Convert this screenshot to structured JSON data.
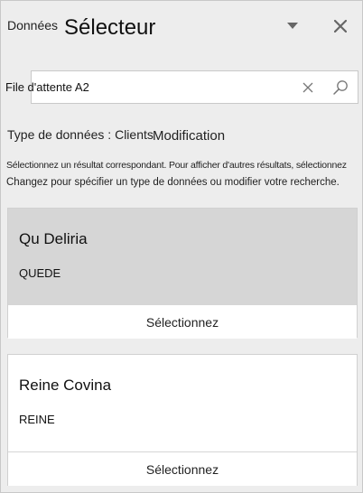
{
  "header": {
    "crumb": "Données",
    "title": "Sélecteur"
  },
  "icons": {
    "dropdown": "caret-down-icon",
    "close": "close-icon",
    "clear": "clear-icon",
    "search": "search-icon"
  },
  "search": {
    "value": "File d'attente A2"
  },
  "type_row": {
    "label": "Type de données : Clients",
    "edit_label": "Modification"
  },
  "hints": {
    "line1": "Sélectionnez un résultat correspondant. Pour afficher d'autres résultats, sélectionnez",
    "line2": "Changez pour spécifier un type de données ou modifier votre recherche."
  },
  "results": [
    {
      "name": "Qu Deliria",
      "code": "QUEDE",
      "select_label": "Sélectionnez",
      "highlighted": true
    },
    {
      "name": "Reine Covina",
      "code": "REINE",
      "select_label": "Sélectionnez",
      "highlighted": false
    }
  ],
  "colors": {
    "pane_bg": "#ededed",
    "highlight_bg": "#d6d6d6",
    "icon": "#666666"
  }
}
